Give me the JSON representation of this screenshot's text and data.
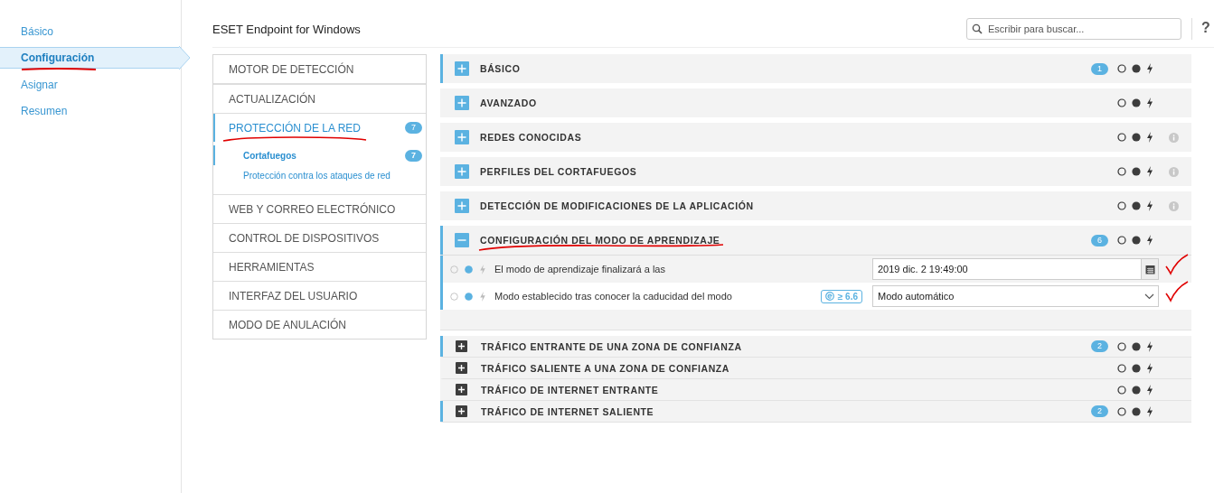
{
  "nav": {
    "items": [
      {
        "label": "Básico",
        "selected": false
      },
      {
        "label": "Configuración",
        "selected": true
      },
      {
        "label": "Asignar",
        "selected": false
      },
      {
        "label": "Resumen",
        "selected": false
      }
    ]
  },
  "header": {
    "title": "ESET Endpoint for Windows",
    "search": {
      "placeholder": "Escribir para buscar..."
    },
    "help": "?"
  },
  "categories": [
    {
      "label": "MOTOR DE DETECCIÓN",
      "selected": false
    },
    {
      "label": "ACTUALIZACIÓN",
      "selected": false
    },
    {
      "label": "PROTECCIÓN DE LA RED",
      "selected": true,
      "count": "7",
      "children": [
        {
          "label": "Cortafuegos",
          "selected": true,
          "count": "7"
        },
        {
          "label": "Protección contra los ataques de red",
          "selected": false
        }
      ]
    },
    {
      "label": "WEB Y CORREO ELECTRÓNICO",
      "selected": false
    },
    {
      "label": "CONTROL DE DISPOSITIVOS",
      "selected": false
    },
    {
      "label": "HERRAMIENTAS",
      "selected": false
    },
    {
      "label": "INTERFAZ DEL USUARIO",
      "selected": false
    },
    {
      "label": "MODO DE ANULACIÓN",
      "selected": false
    }
  ],
  "sections": [
    {
      "kind": "group",
      "title": "BÁSICO",
      "count": "1",
      "highlighted": true,
      "expanded": false,
      "info": false
    },
    {
      "kind": "group",
      "title": "AVANZADO",
      "highlighted": false,
      "expanded": false,
      "info": false
    },
    {
      "kind": "group",
      "title": "REDES CONOCIDAS",
      "highlighted": false,
      "expanded": false,
      "info": true
    },
    {
      "kind": "group",
      "title": "PERFILES DEL CORTAFUEGOS",
      "highlighted": false,
      "expanded": false,
      "info": true
    },
    {
      "kind": "group",
      "title": "DETECCIÓN DE MODIFICACIONES DE LA APLICACIÓN",
      "highlighted": false,
      "expanded": false,
      "info": true
    },
    {
      "kind": "group",
      "title": "CONFIGURACIÓN DEL MODO DE APRENDIZAJE",
      "count": "6",
      "highlighted": true,
      "expanded": true,
      "info": false,
      "settings": [
        {
          "kind": "date",
          "label": "El modo de aprendizaje finalizará a las",
          "value": "2019 dic. 2 19:49:00"
        },
        {
          "kind": "select",
          "label": "Modo establecido tras conocer la caducidad del modo",
          "version": "≥ 6.6",
          "value": "Modo automático"
        }
      ]
    },
    {
      "kind": "rule",
      "title": "TRÁFICO ENTRANTE DE UNA ZONA DE CONFIANZA",
      "count": "2",
      "highlighted": true,
      "expanded": false,
      "info": false
    },
    {
      "kind": "rule",
      "title": "TRÁFICO SALIENTE A UNA ZONA DE CONFIANZA",
      "highlighted": false,
      "expanded": false,
      "info": false
    },
    {
      "kind": "rule",
      "title": "TRÁFICO DE INTERNET ENTRANTE",
      "highlighted": false,
      "expanded": false,
      "info": false
    },
    {
      "kind": "rule",
      "title": "TRÁFICO DE INTERNET SALIENTE",
      "count": "2",
      "highlighted": true,
      "expanded": false,
      "info": false
    }
  ]
}
